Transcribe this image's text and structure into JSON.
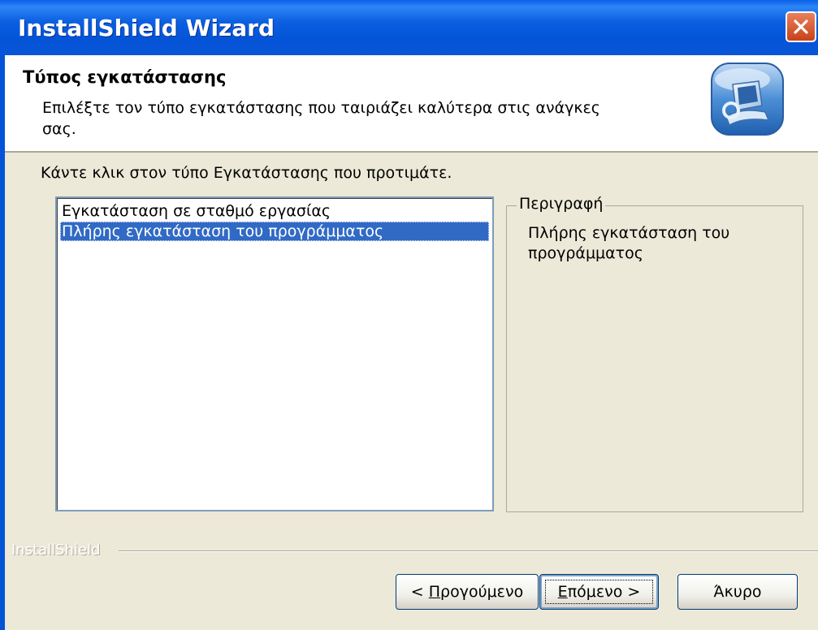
{
  "window": {
    "title": "InstallShield Wizard"
  },
  "header": {
    "title": "Τύπος εγκατάστασης",
    "subtitle": "Επιλέξτε τον τύπο εγκατάστασης που ταιριάζει καλύτερα στις ανάγκες σας.",
    "icon": "setup-computer-icon"
  },
  "main": {
    "instruction": "Κάντε κλικ στον τύπο Εγκατάστασης που προτιμάτε.",
    "setup_types": [
      {
        "label": "Εγκατάσταση σε σταθμό εργασίας",
        "selected": false
      },
      {
        "label": "Πλήρης εγκατάσταση του προγράμματος",
        "selected": true
      }
    ],
    "description": {
      "label": "Περιγραφή",
      "text": "Πλήρης εγκατάσταση του προγράμματος"
    }
  },
  "footer": {
    "brand": "InstallShield",
    "back_prefix": "< ",
    "back_hotkey": "Π",
    "back_rest": "ρογούμενο",
    "next_hotkey": "Ε",
    "next_rest": "πόμενο >",
    "cancel_label": "Άκυρο"
  },
  "colors": {
    "titlebar": "#0454D7",
    "selection": "#316AC5",
    "dialog_bg": "#ECE9D8",
    "close": "#C8421A"
  }
}
